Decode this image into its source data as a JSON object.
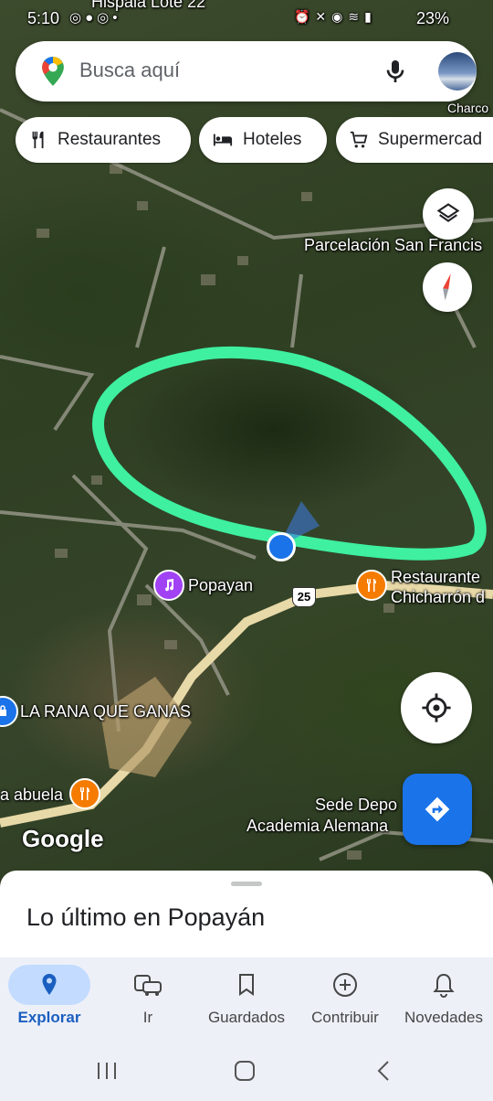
{
  "status_bar": {
    "time": "5:10",
    "battery": "23%",
    "left_icons": [
      "instagram-icon",
      "chat-icon",
      "instagram-icon",
      "dot-icon"
    ],
    "right_icons": [
      "alarm-icon",
      "mute-icon",
      "location-icon",
      "wifi-icon",
      "lte-icon",
      "signal-icon"
    ]
  },
  "map_top_cut_label": "Hispala Lote 22",
  "search": {
    "placeholder": "Busca aquí"
  },
  "chips": [
    {
      "label": "Restaurantes",
      "icon": "fork-knife-icon"
    },
    {
      "label": "Hoteles",
      "icon": "bed-icon"
    },
    {
      "label": "Supermercad",
      "icon": "cart-icon"
    }
  ],
  "map_labels": {
    "parcelacion": "Parcelación San Francis",
    "charco": "Charco",
    "popayan_poi": "Popayan",
    "restaurante_line1": "Restaurante",
    "restaurante_line2": "Chicharrón d",
    "rana": "LA RANA QUE GANAS",
    "abuela": "a abuela",
    "sede_line1": "Sede Depo",
    "sede_line2": "Academia Alemana",
    "highway": "25",
    "google": "Google"
  },
  "sheet": {
    "title": "Lo último en Popayán"
  },
  "bottom_nav": [
    {
      "label": "Explorar",
      "icon": "location-pin-icon",
      "active": true
    },
    {
      "label": "Ir",
      "icon": "commute-icon",
      "active": false
    },
    {
      "label": "Guardados",
      "icon": "bookmark-icon",
      "active": false
    },
    {
      "label": "Contribuir",
      "icon": "add-circle-icon",
      "active": false
    },
    {
      "label": "Novedades",
      "icon": "bell-icon",
      "active": false
    }
  ],
  "colors": {
    "highlight_stroke": "#3ef0a0",
    "accent_blue": "#1a73e8",
    "restaurant_poi": "#f57c00",
    "music_poi": "#a142f4",
    "road": "#e8d9a8"
  }
}
